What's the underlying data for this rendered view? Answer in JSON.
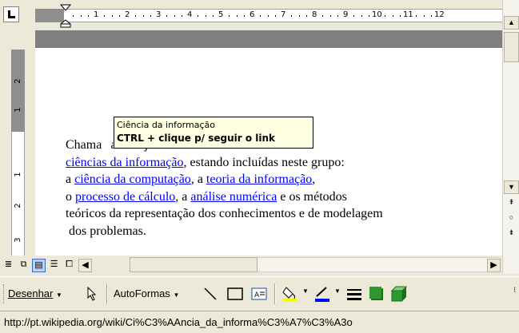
{
  "ruler": {
    "numbers": [
      "1",
      "2",
      "3",
      "4",
      "5",
      "6",
      "7",
      "8",
      "9",
      "10",
      "11",
      "12"
    ],
    "vnumbers": [
      "2",
      "1",
      "1",
      "2",
      "3"
    ]
  },
  "tooltip": {
    "line1": "Ciência da informação",
    "line2": "CTRL + clique p/ seguir o link"
  },
  "document": {
    "line1_start": "Chama",
    "line1_hidden": "a",
    "line1_end": " ao conjunto das",
    "link1": "ciências da informação",
    "line2_end": ", estando incluídas neste grupo:",
    "line3_start": "a ",
    "link2": "ciência da computação",
    "line3_mid": ", a ",
    "link3": "teoria da informação",
    "line3_end": ",",
    "line4_start": "o ",
    "link4": "processo de cálculo",
    "line4_mid": ", a ",
    "link5": "análise numérica",
    "line4_end": " e os métodos",
    "line5": "teóricos da representação dos conhecimentos e de modelagem",
    "line6": " dos problemas."
  },
  "drawing_toolbar": {
    "draw_label": "Desenhar",
    "autoshapes_label": "AutoFormas"
  },
  "status": {
    "url": "http://pt.wikipedia.org/wiki/Ci%C3%AAncia_da_informa%C3%A7%C3%A3o"
  },
  "colors": {
    "fill_bucket": "#ffff00",
    "line_color": "#0000ff",
    "shadow_green": "#2e9a2e"
  }
}
